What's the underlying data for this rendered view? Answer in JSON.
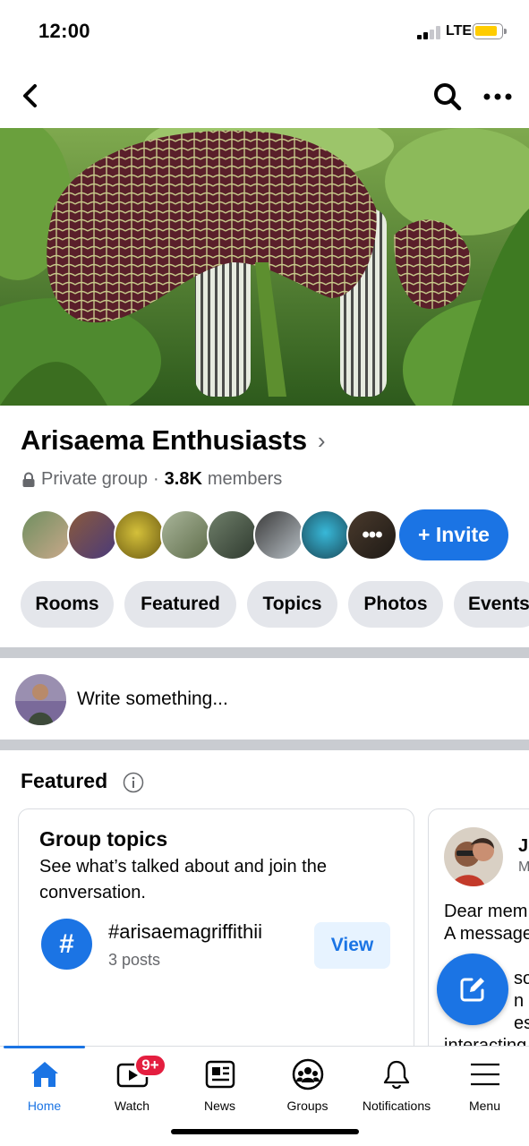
{
  "status_bar": {
    "time": "12:00",
    "network": "LTE"
  },
  "group": {
    "name": "Arisaema Enthusiasts",
    "privacy": "Private group",
    "separator": "·",
    "member_count": "3.8K",
    "members_label": "members",
    "more_members_glyph": "•••",
    "invite_label": "+ Invite"
  },
  "chips": [
    "Rooms",
    "Featured",
    "Topics",
    "Photos",
    "Events"
  ],
  "composer": {
    "placeholder": "Write something..."
  },
  "featured": {
    "title": "Featured",
    "topics_card": {
      "title": "Group topics",
      "description": "See what’s talked about and join the conversation.",
      "topic_name": "#arisaemagriffithii",
      "topic_count": "3 posts",
      "view_label": "View",
      "hash_glyph": "#"
    },
    "post_card": {
      "author_initial": "J",
      "author_sub": "M",
      "text_lines": [
        "Dear mem",
        "A message",
        "",
        "son",
        "n m",
        "es i",
        "interacting"
      ]
    }
  },
  "tabbar": {
    "home": "Home",
    "watch": "Watch",
    "watch_badge": "9+",
    "news": "News",
    "groups": "Groups",
    "notifications": "Notifications",
    "menu": "Menu"
  },
  "colors": {
    "accent": "#1b74e4",
    "badge": "#e41e3f",
    "chip_bg": "#e4e6eb",
    "battery": "#ffcc00"
  },
  "icons": [
    "back-icon",
    "search-icon",
    "more-icon",
    "lock-icon",
    "info-icon",
    "hash-icon",
    "compose-icon",
    "home-icon",
    "watch-icon",
    "news-icon",
    "groups-icon",
    "bell-icon",
    "menu-icon"
  ]
}
